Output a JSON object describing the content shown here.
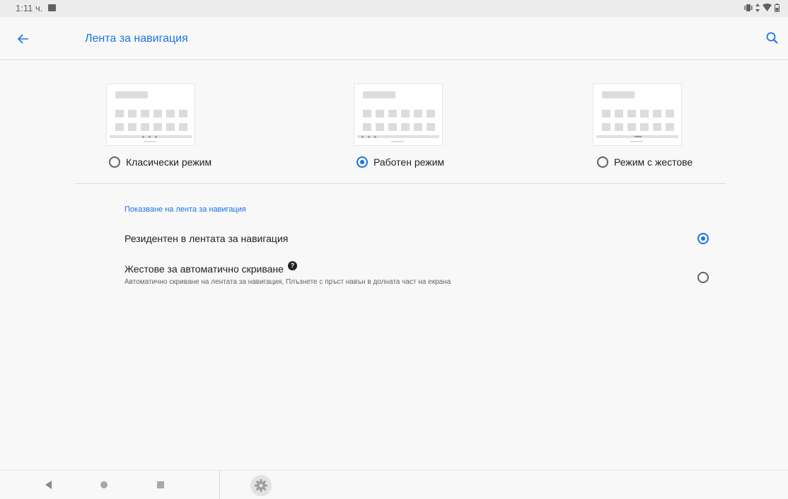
{
  "status_bar": {
    "time": "1:11 ч.",
    "icons": [
      "gallery-notification-icon",
      "vibrate-icon",
      "data-arrows-icon",
      "wifi-icon",
      "battery-icon"
    ]
  },
  "app_bar": {
    "title": "Лента за навигация",
    "back_icon": "arrow-back-icon",
    "search_icon": "search-icon"
  },
  "modes": [
    {
      "label": "Класически режим",
      "selected": false
    },
    {
      "label": "Работен режим",
      "selected": true
    },
    {
      "label": "Режим с жестове",
      "selected": false
    }
  ],
  "section": {
    "header": "Показване на лента за навигация",
    "options": [
      {
        "title": "Резидентен в лентата за навигация",
        "summary": "",
        "selected": true
      },
      {
        "title": "Жестове за автоматично скриване",
        "summary": "Автоматично скриване на лентата за навигация, Плъзнете с пръст навън в долната част на екрана",
        "selected": false,
        "help_icon": "?"
      }
    ]
  },
  "colors": {
    "accent": "#1a73e8",
    "text": "#202124",
    "secondary": "#5f6368",
    "background": "#f8f8f8"
  },
  "system_nav": {
    "icons": [
      "nav-back-icon",
      "nav-home-icon",
      "nav-recents-icon",
      "settings-gear-icon"
    ]
  }
}
